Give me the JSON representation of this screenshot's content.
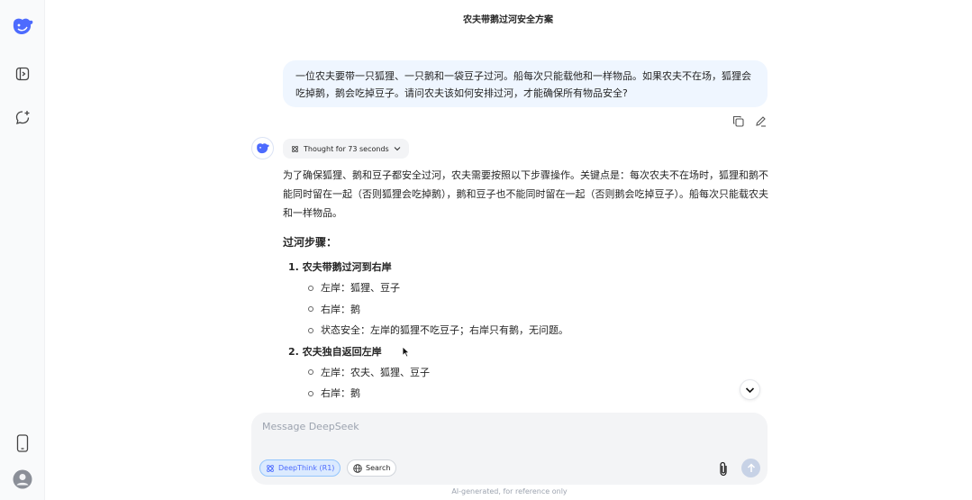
{
  "header": {
    "title": "农夫带鹅过河安全方案"
  },
  "sidebar": {
    "icons": [
      "whale-logo-icon",
      "sidebar-toggle-icon",
      "new-chat-icon",
      "mobile-app-icon",
      "user-avatar-icon"
    ]
  },
  "user_message": {
    "text": "一位农夫要带一只狐狸、一只鹅和一袋豆子过河。船每次只能载他和一样物品。如果农夫不在场，狐狸会吃掉鹅，鹅会吃掉豆子。请问农夫该如何安排过河，才能确保所有物品安全?"
  },
  "assistant": {
    "thought_label": "Thought for 73 seconds",
    "intro": "为了确保狐狸、鹅和豆子都安全过河，农夫需要按照以下步骤操作。关键点是：每次农夫不在场时，狐狸和鹅不能同时留在一起（否则狐狸会吃掉鹅），鹅和豆子也不能同时留在一起（否则鹅会吃掉豆子）。船每次只能载农夫和一样物品。",
    "steps_heading": "过河步骤：",
    "steps": [
      {
        "title": "1. 农夫带鹅过河到右岸",
        "items": [
          "左岸：狐狸、豆子",
          "右岸：鹅",
          "状态安全：左岸的狐狸不吃豆子；右岸只有鹅，无问题。"
        ]
      },
      {
        "title": "2. 农夫独自返回左岸",
        "items": [
          "左岸：农夫、狐狸、豆子",
          "右岸：鹅"
        ]
      }
    ]
  },
  "composer": {
    "placeholder": "Message DeepSeek",
    "deepthink_label": "DeepThink (R1)",
    "search_label": "Search"
  },
  "footer": {
    "note": "AI-generated, for reference only"
  },
  "colors": {
    "accent": "#4d6bfe",
    "bubble": "#eff6ff"
  }
}
